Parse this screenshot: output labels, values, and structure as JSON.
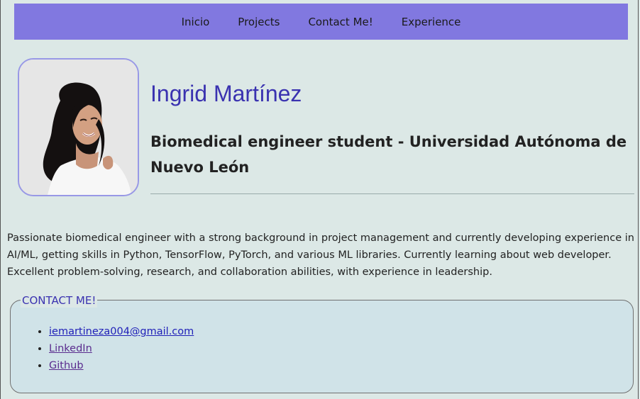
{
  "nav": {
    "items": [
      {
        "label": "Inicio"
      },
      {
        "label": "Projects"
      },
      {
        "label": "Contact Me!"
      },
      {
        "label": "Experience"
      }
    ]
  },
  "profile": {
    "name": "Ingrid Martínez",
    "role": "Biomedical engineer student - Universidad Autónoma de Nuevo León",
    "bio": "Passionate biomedical engineer with a strong background in project management and currently developing experience in AI/ML, getting skills in Python, TensorFlow, PyTorch, and various ML libraries. Currently learning about web developer. Excellent problem-solving, research, and collaboration abilities, with experience in leadership."
  },
  "contact": {
    "legend": "CONTACT ME!",
    "links": [
      {
        "label": "iemartineza004@gmail.com"
      },
      {
        "label": "LinkedIn"
      },
      {
        "label": "Github"
      }
    ]
  },
  "colors": {
    "nav_background": "#8178e0",
    "page_background": "#dce8e6",
    "name_color": "#3a32b0",
    "avatar_border": "#9898e6",
    "contact_background": "#d0e3e8"
  }
}
